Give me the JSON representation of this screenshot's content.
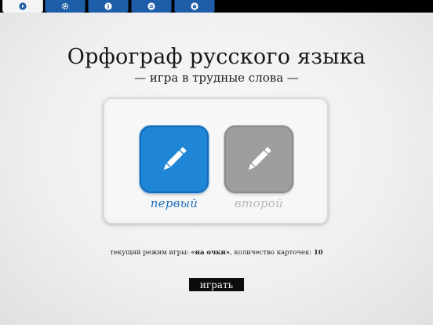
{
  "tabs": [
    {
      "icon": "play-icon",
      "active": true
    },
    {
      "icon": "gear-icon",
      "active": false
    },
    {
      "icon": "info-icon",
      "active": false
    },
    {
      "icon": "list-icon",
      "active": false
    },
    {
      "icon": "basket-icon",
      "active": false
    }
  ],
  "header": {
    "title": "Орфограф русского языка",
    "subtitle": "— игра в трудные слова —"
  },
  "players": [
    {
      "label": "первый",
      "icon": "pencil-icon",
      "selected": true,
      "color": "#1f86d6"
    },
    {
      "label": "второй",
      "icon": "pencil-icon",
      "selected": false,
      "color": "#9e9e9e"
    }
  ],
  "status": {
    "mode_prefix": "текущий режим игры: ",
    "mode_value": "«на очки»",
    "count_prefix": ", количество карточек: ",
    "count_value": "10"
  },
  "play_label": "играть"
}
